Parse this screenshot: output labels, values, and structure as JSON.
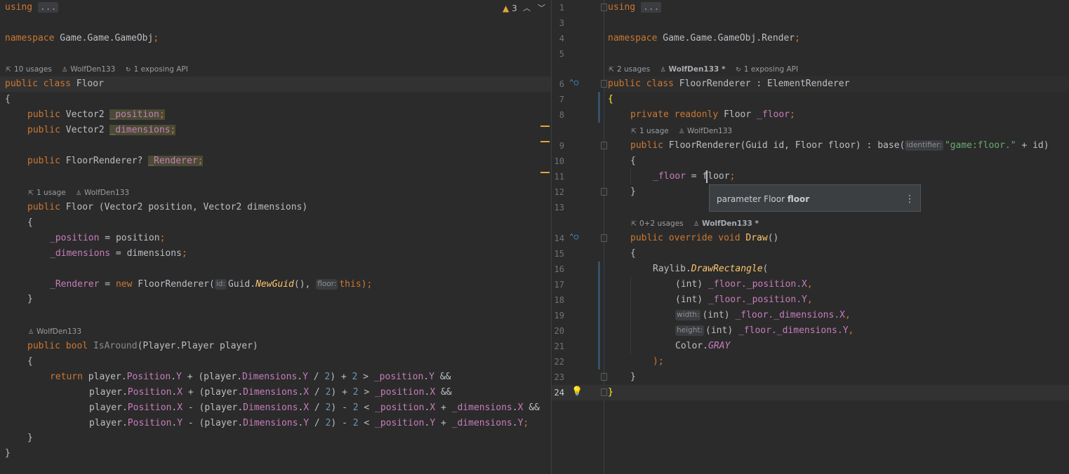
{
  "left": {
    "warnings": {
      "count": "3"
    },
    "lines": {
      "using_kw": "using",
      "using_dots": "...",
      "namespace_kw": "namespace",
      "namespace_name": "Game.Game.GameObj",
      "lens1": {
        "usages": "10 usages",
        "author": "WolfDen133",
        "api": "1 exposing API"
      },
      "class_decl": {
        "kw1": "public",
        "kw2": "class",
        "name": "Floor"
      },
      "brace_open": "{",
      "field1": {
        "kw": "public",
        "type": "Vector2",
        "name": "_position"
      },
      "field2": {
        "kw": "public",
        "type": "Vector2",
        "name": "_dimensions"
      },
      "field3": {
        "kw": "public",
        "type": "FloorRenderer?",
        "name": "_Renderer"
      },
      "lens2": {
        "usages": "1 usage",
        "author": "WolfDen133"
      },
      "ctor": {
        "kw": "public",
        "name": "Floor",
        "params": " (Vector2 position, Vector2 dimensions)"
      },
      "ctor_open": "{",
      "assign1": {
        "lhs": "_position",
        "rhs": "position"
      },
      "assign2": {
        "lhs": "_dimensions",
        "rhs": "dimensions"
      },
      "assign3": {
        "lhs": "_Renderer",
        "op": " = ",
        "kw": "new",
        "type": "FloorRenderer(",
        "hint1": "id:",
        "guid": "Guid.",
        "method": "NewGuid",
        "args": "(), ",
        "hint2": "floor:",
        "this": "this",
        "end": ");"
      },
      "ctor_close": "}",
      "lens3": {
        "author": "WolfDen133"
      },
      "isaround": {
        "kw1": "public",
        "kw2": "bool",
        "name": "IsAround",
        "params": "(Player.Player player)"
      },
      "ia_open": "{",
      "ret1": "return",
      "ia_close": "}",
      "class_close": "}"
    }
  },
  "right": {
    "line_numbers": [
      "1",
      "3",
      "4",
      "5",
      "6",
      "7",
      "8",
      "9",
      "10",
      "11",
      "12",
      "13",
      "14",
      "15",
      "16",
      "17",
      "18",
      "19",
      "20",
      "21",
      "22",
      "23",
      "24"
    ],
    "lines": {
      "using_kw": "using",
      "using_dots": "...",
      "namespace_kw": "namespace",
      "namespace_name": "Game.Game.GameObj.Render",
      "lens1": {
        "usages": "2 usages",
        "author": "WolfDen133 *",
        "api": "1 exposing API"
      },
      "class_decl": {
        "kw1": "public",
        "kw2": "class",
        "name": "FloorRenderer",
        "base": " : ElementRenderer"
      },
      "brace_open": "{",
      "field": {
        "kw1": "private",
        "kw2": "readonly",
        "type": "Floor",
        "name": "_floor"
      },
      "lens2": {
        "usages": "1 usage",
        "author": "WolfDen133"
      },
      "ctor": {
        "kw": "public",
        "sig": "FloorRenderer(Guid id, Floor floor) : ",
        "base": "base(",
        "hint": "identifier:",
        "str": "\"game:floor.\"",
        "rest": " + id)"
      },
      "ctor_open": "{",
      "assign": {
        "lhs": "_floor",
        "op": " = ",
        "rhs": "floor"
      },
      "ctor_close": "}",
      "lens3": {
        "usages": "0+2 usages",
        "author": "WolfDen133 *"
      },
      "draw": {
        "kw1": "public",
        "kw2": "override",
        "kw3": "void",
        "name": "Draw",
        "params": "()"
      },
      "draw_open": "{",
      "raylib": {
        "obj": "Raylib.",
        "method": "DrawRectangle",
        "paren": "("
      },
      "arg1": {
        "cast": "(int) ",
        "field": "_floor._position.",
        "prop": "X"
      },
      "arg2": {
        "cast": "(int) ",
        "field": "_floor._position.",
        "prop": "Y"
      },
      "arg3": {
        "hint": "width:",
        "cast": "(int) ",
        "field": "_floor._dimensions.",
        "prop": "X"
      },
      "arg4": {
        "hint": "height:",
        "cast": "(int) ",
        "field": "_floor._dimensions.",
        "prop": "Y"
      },
      "arg5": {
        "obj": "Color.",
        "val": "GRAY"
      },
      "call_close": ");",
      "draw_close": "}",
      "class_close": "}"
    },
    "tooltip": {
      "prefix": "parameter Floor ",
      "name": "floor"
    }
  }
}
